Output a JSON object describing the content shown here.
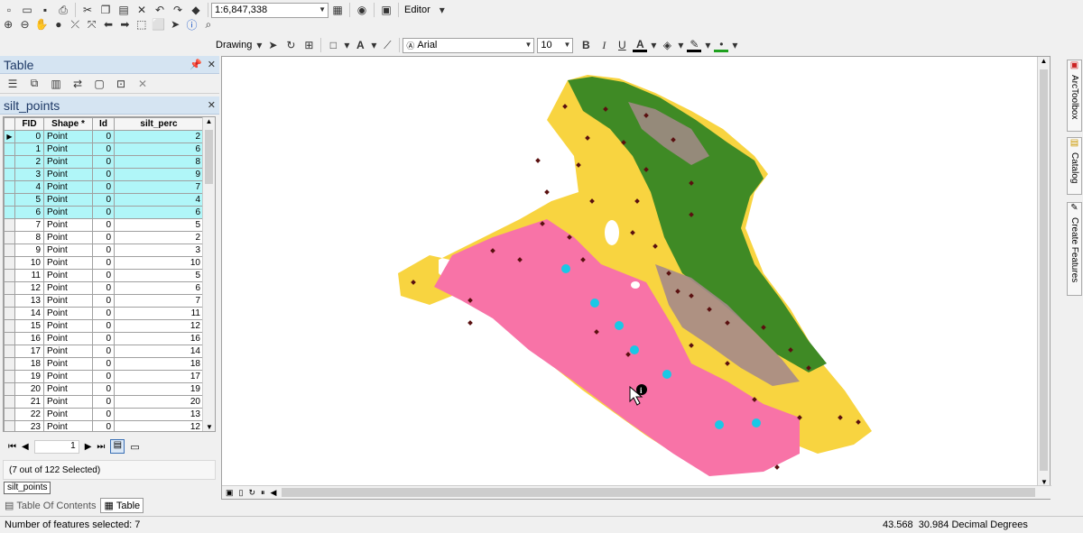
{
  "toolbar1": {
    "scale_value": "1:6,847,338",
    "editor_label": "Editor"
  },
  "toolbar2": {
    "drawing_label": "Drawing",
    "font_name": "Arial",
    "font_size": "10",
    "bold": "B",
    "italic": "I",
    "underline": "U",
    "text_tool": "A",
    "font_color": "A"
  },
  "table_panel": {
    "title": "Table",
    "layer_tab": "silt_points",
    "columns": [
      "FID",
      "Shape *",
      "Id",
      "silt_perc"
    ],
    "rows": [
      {
        "fid": "0",
        "shape": "Point",
        "id": "0",
        "silt": "2",
        "selected": true
      },
      {
        "fid": "1",
        "shape": "Point",
        "id": "0",
        "silt": "6",
        "selected": true
      },
      {
        "fid": "2",
        "shape": "Point",
        "id": "0",
        "silt": "8",
        "selected": true
      },
      {
        "fid": "3",
        "shape": "Point",
        "id": "0",
        "silt": "9",
        "selected": true
      },
      {
        "fid": "4",
        "shape": "Point",
        "id": "0",
        "silt": "7",
        "selected": true
      },
      {
        "fid": "5",
        "shape": "Point",
        "id": "0",
        "silt": "4",
        "selected": true
      },
      {
        "fid": "6",
        "shape": "Point",
        "id": "0",
        "silt": "6",
        "selected": true
      },
      {
        "fid": "7",
        "shape": "Point",
        "id": "0",
        "silt": "5",
        "selected": false
      },
      {
        "fid": "8",
        "shape": "Point",
        "id": "0",
        "silt": "2",
        "selected": false
      },
      {
        "fid": "9",
        "shape": "Point",
        "id": "0",
        "silt": "3",
        "selected": false
      },
      {
        "fid": "10",
        "shape": "Point",
        "id": "0",
        "silt": "10",
        "selected": false
      },
      {
        "fid": "11",
        "shape": "Point",
        "id": "0",
        "silt": "5",
        "selected": false
      },
      {
        "fid": "12",
        "shape": "Point",
        "id": "0",
        "silt": "6",
        "selected": false
      },
      {
        "fid": "13",
        "shape": "Point",
        "id": "0",
        "silt": "7",
        "selected": false
      },
      {
        "fid": "14",
        "shape": "Point",
        "id": "0",
        "silt": "11",
        "selected": false
      },
      {
        "fid": "15",
        "shape": "Point",
        "id": "0",
        "silt": "12",
        "selected": false
      },
      {
        "fid": "16",
        "shape": "Point",
        "id": "0",
        "silt": "16",
        "selected": false
      },
      {
        "fid": "17",
        "shape": "Point",
        "id": "0",
        "silt": "14",
        "selected": false
      },
      {
        "fid": "18",
        "shape": "Point",
        "id": "0",
        "silt": "18",
        "selected": false
      },
      {
        "fid": "19",
        "shape": "Point",
        "id": "0",
        "silt": "17",
        "selected": false
      },
      {
        "fid": "20",
        "shape": "Point",
        "id": "0",
        "silt": "19",
        "selected": false
      },
      {
        "fid": "21",
        "shape": "Point",
        "id": "0",
        "silt": "20",
        "selected": false
      },
      {
        "fid": "22",
        "shape": "Point",
        "id": "0",
        "silt": "13",
        "selected": false
      },
      {
        "fid": "23",
        "shape": "Point",
        "id": "0",
        "silt": "12",
        "selected": false
      }
    ],
    "page_number": "1",
    "selection_status": "(7 out of 122 Selected)",
    "bottom_tab_layer": "silt_points",
    "tab_toc": "Table Of Contents",
    "tab_table": "Table"
  },
  "side_tabs": [
    "ArcToolbox",
    "Catalog",
    "Create Features"
  ],
  "status_bar": {
    "left_text": "Number of features selected: 7",
    "coords": "43.568  30.984 Decimal Degrees"
  },
  "colors": {
    "selected_row": "#b0f6f8",
    "panel_title_bg": "#d5e4f2",
    "yellow_zone": "#f8d440",
    "pink_zone": "#f873a7",
    "green_zone": "#3f8a25",
    "mauve_zone": "#a58a8a",
    "point_dark": "#5a1010",
    "point_selected": "#1ac8e6"
  }
}
